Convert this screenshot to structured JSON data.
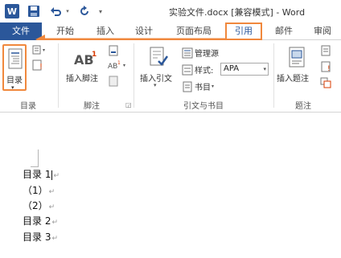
{
  "title_bar": {
    "app_logo": "W",
    "document_title": "实验文件.docx [兼容模式] - Word"
  },
  "tabs": [
    {
      "label": "文件"
    },
    {
      "label": "开始"
    },
    {
      "label": "插入"
    },
    {
      "label": "设计"
    },
    {
      "label": "页面布局"
    },
    {
      "label": "引用"
    },
    {
      "label": "邮件"
    },
    {
      "label": "审阅"
    }
  ],
  "ribbon": {
    "toc_group": {
      "button_label": "目录",
      "group_label": "目录"
    },
    "footnote_group": {
      "insert_footnote_label": "插入脚注",
      "group_label": "脚注"
    },
    "citation_group": {
      "insert_citation_label": "插入引文",
      "manage_sources_label": "管理源",
      "style_label": "样式:",
      "style_value": "APA",
      "bibliography_label": "书目",
      "group_label": "引文与书目"
    },
    "caption_group": {
      "insert_caption_label": "插入题注",
      "group_label": "题注"
    }
  },
  "document": {
    "lines": [
      "目录 1",
      "（1）",
      "（2）",
      "目录 2",
      "目录 3"
    ],
    "paragraph_mark": "↵"
  },
  "colors": {
    "brand_blue": "#2b579a",
    "highlight_orange": "#f0883d"
  }
}
